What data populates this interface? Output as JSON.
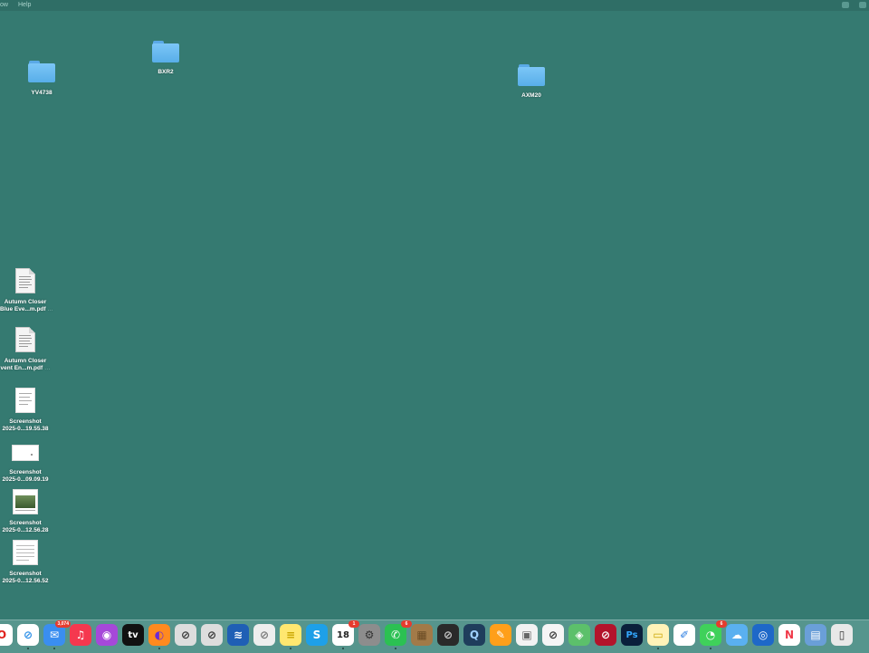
{
  "menubar": {
    "items": [
      "ow",
      "Help"
    ]
  },
  "desktop": {
    "folders": [
      {
        "name": "YV4738"
      },
      {
        "name": "BXR2"
      },
      {
        "name": "AXM20"
      }
    ],
    "files": [
      {
        "line1": "Autumn Closer",
        "line2": "Blue Eve...m.pdf",
        "suffix": "…"
      },
      {
        "line1": "Autumn Closer",
        "line2": "vent En...m.pdf",
        "suffix": "…"
      },
      {
        "line1": "Screenshot",
        "line2": "2025-0...19.55.38"
      },
      {
        "line1": "Screenshot",
        "line2": "2025-0...09.09.19"
      },
      {
        "line1": "Screenshot",
        "line2": "2025-0...12.56.28"
      },
      {
        "line1": "Screenshot",
        "line2": "2025-0...12.56.52"
      }
    ]
  },
  "dock": {
    "icons": [
      {
        "name": "opera-icon",
        "glyph": "O",
        "bg": "#ffffff",
        "fg": "#e0201b",
        "running": false
      },
      {
        "name": "safari-icon",
        "glyph": "⊘",
        "bg": "#ffffff",
        "fg": "#2a8ee8",
        "running": true
      },
      {
        "name": "mail-icon",
        "glyph": "✉",
        "bg": "#3a8ef0",
        "fg": "#ffffff",
        "badge": "3,074",
        "running": true
      },
      {
        "name": "music-icon",
        "glyph": "♫",
        "bg": "#f5384f",
        "fg": "#ffffff",
        "running": false
      },
      {
        "name": "podcasts-icon",
        "glyph": "◉",
        "bg": "#a648d9",
        "fg": "#ffffff",
        "running": false
      },
      {
        "name": "apple-tv-icon",
        "glyph": "tv",
        "bg": "#111111",
        "fg": "#ffffff",
        "running": false
      },
      {
        "name": "firefox-icon",
        "glyph": "◐",
        "bg": "#ff8a1f",
        "fg": "#6b2ad6",
        "running": true
      },
      {
        "name": "disabled-app-icon",
        "glyph": "⊘",
        "bg": "#dddddd",
        "fg": "#333333",
        "running": false
      },
      {
        "name": "disabled-app-icon",
        "glyph": "⊘",
        "bg": "#dddddd",
        "fg": "#333333",
        "running": false
      },
      {
        "name": "cyberduck-icon",
        "glyph": "≋",
        "bg": "#1f5fb5",
        "fg": "#ffffff",
        "running": false
      },
      {
        "name": "disabled-app-icon",
        "glyph": "⊘",
        "bg": "#eeeeee",
        "fg": "#777777",
        "running": false
      },
      {
        "name": "notes-icon",
        "glyph": "≡",
        "bg": "#ffe770",
        "fg": "#c9a400",
        "running": true
      },
      {
        "name": "skype-icon",
        "glyph": "S",
        "bg": "#1ea0e8",
        "fg": "#ffffff",
        "running": false
      },
      {
        "name": "calendar-icon",
        "glyph": "18",
        "bg": "#ffffff",
        "fg": "#222222",
        "badge": "1",
        "running": true
      },
      {
        "name": "system-settings-icon",
        "glyph": "⚙",
        "bg": "#8d8d8d",
        "fg": "#333333",
        "running": false
      },
      {
        "name": "whatsapp-icon",
        "glyph": "✆",
        "bg": "#2bc152",
        "fg": "#ffffff",
        "badge": "6",
        "running": true
      },
      {
        "name": "archive-icon",
        "glyph": "▦",
        "bg": "#a27a48",
        "fg": "#6b4c25",
        "running": false
      },
      {
        "name": "disabled-app-icon",
        "glyph": "⊘",
        "bg": "#2a2a2a",
        "fg": "#cccccc",
        "running": false
      },
      {
        "name": "quicktime-icon",
        "glyph": "Q",
        "bg": "#1f3d5c",
        "fg": "#9fd1ff",
        "running": false
      },
      {
        "name": "pages-icon",
        "glyph": "✎",
        "bg": "#ff9f1a",
        "fg": "#ffffff",
        "running": false
      },
      {
        "name": "preview-icon",
        "glyph": "▣",
        "bg": "#f2f2f2",
        "fg": "#666666",
        "running": false
      },
      {
        "name": "disabled-app-icon",
        "glyph": "⊘",
        "bg": "#f5f5f5",
        "fg": "#333333",
        "running": false
      },
      {
        "name": "maps-icon",
        "glyph": "◈",
        "bg": "#5cc06b",
        "fg": "#ffffff",
        "running": false
      },
      {
        "name": "disabled-app-icon",
        "glyph": "⊘",
        "bg": "#b3132b",
        "fg": "#ffffff",
        "running": false
      },
      {
        "name": "photoshop-icon",
        "glyph": "Ps",
        "bg": "#0a1f3b",
        "fg": "#33a8ff",
        "running": false
      },
      {
        "name": "notes-alt-icon",
        "glyph": "▭",
        "bg": "#fff3b8",
        "fg": "#c9a400",
        "running": true
      },
      {
        "name": "freeform-icon",
        "glyph": "✐",
        "bg": "#ffffff",
        "fg": "#2a7de1",
        "running": false
      },
      {
        "name": "messages-icon",
        "glyph": "◔",
        "bg": "#3fd15a",
        "fg": "#ffffff",
        "badge": "6",
        "running": true
      },
      {
        "name": "cloud-app-icon",
        "glyph": "☁",
        "bg": "#5ab0f0",
        "fg": "#ffffff",
        "running": false
      },
      {
        "name": "eye-app-icon",
        "glyph": "◎",
        "bg": "#1e68c8",
        "fg": "#ffffff",
        "running": false
      },
      {
        "name": "news-icon",
        "glyph": "N",
        "bg": "#ffffff",
        "fg": "#f03a4a",
        "running": false
      },
      {
        "name": "image-app-icon",
        "glyph": "▤",
        "bg": "#6a9fd8",
        "fg": "#ffffff",
        "running": false
      },
      {
        "name": "iphone-mirroring-icon",
        "glyph": "▯",
        "bg": "#e8e8e8",
        "fg": "#333333",
        "running": false
      }
    ]
  }
}
